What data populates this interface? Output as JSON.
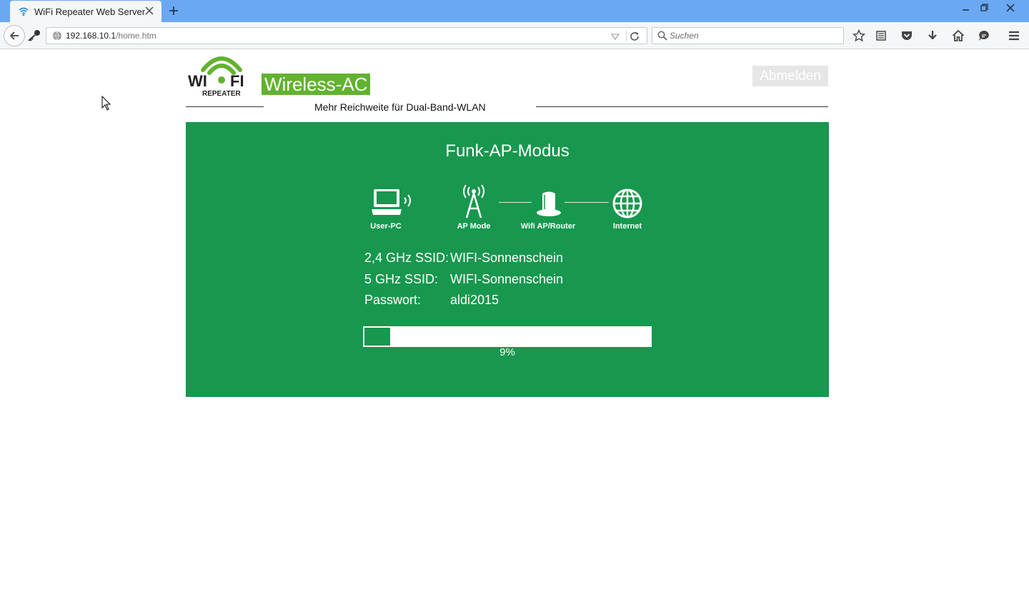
{
  "browser": {
    "tab_title": "WiFi Repeater Web Server",
    "url_host": "192.168.10.1",
    "url_path": "/home.htm",
    "search_placeholder": "Suchen",
    "accent_color": "#6aa9f2"
  },
  "header": {
    "logo_wi": "WI",
    "logo_fi": "FI",
    "logo_sub": "REPEATER",
    "brand": "Wireless-AC",
    "tagline": "Mehr Reichweite für Dual-Band-WLAN",
    "logout_label": "Abmelden",
    "brand_color": "#62b22f"
  },
  "panel": {
    "title": "Funk-AP-Modus",
    "background_color": "#18974e",
    "diagram": [
      {
        "label": "User-PC",
        "icon": "laptop-icon"
      },
      {
        "label": "AP Mode",
        "icon": "antenna-icon"
      },
      {
        "label": "Wifi AP/Router",
        "icon": "router-icon"
      },
      {
        "label": "Internet",
        "icon": "globe-icon"
      }
    ],
    "info": [
      {
        "label": "2,4 GHz SSID:",
        "value": "WIFI-Sonnenschein"
      },
      {
        "label": "5 GHz SSID:",
        "value": "WIFI-Sonnenschein"
      },
      {
        "label": "Passwort:",
        "value": "aldi2015"
      }
    ],
    "progress": {
      "percent": 9,
      "label": "9%"
    }
  }
}
